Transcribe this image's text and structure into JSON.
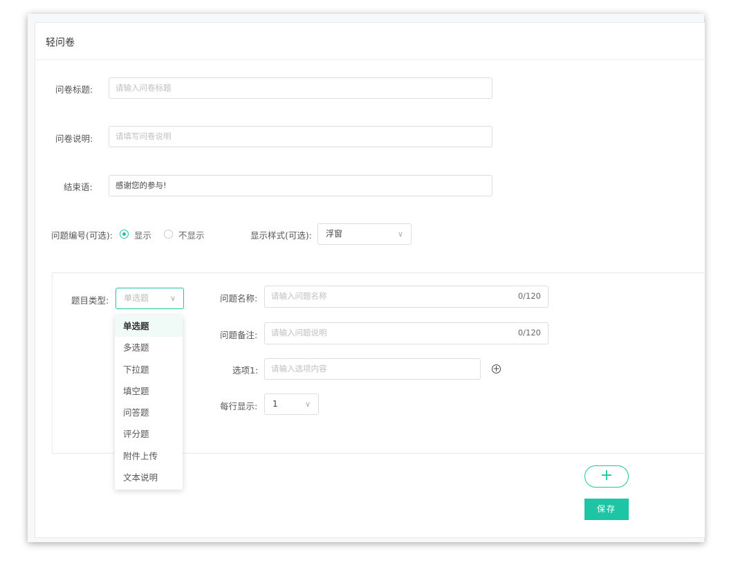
{
  "header": {
    "title": "轻问卷"
  },
  "form": {
    "title_label": "问卷标题:",
    "title_placeholder": "请输入问卷标题",
    "desc_label": "问卷说明:",
    "desc_placeholder": "请填写问卷说明",
    "end_label": "结束语:",
    "end_value": "感谢您的参与!",
    "numbering_label": "问题编号(可选):",
    "numbering_options": [
      "显示",
      "不显示"
    ],
    "numbering_selected": "显示",
    "style_label": "显示样式(可选):",
    "style_value": "浮窗"
  },
  "question": {
    "type_label": "题目类型:",
    "type_placeholder": "单选题",
    "type_options": [
      "单选题",
      "多选题",
      "下拉题",
      "填空题",
      "问答题",
      "评分题",
      "附件上传",
      "文本说明"
    ],
    "type_highlighted": "单选题",
    "name_label": "问题名称:",
    "name_placeholder": "请输入问题名称",
    "name_counter": "0/120",
    "note_label": "问题备注:",
    "note_placeholder": "请输入问题说明",
    "note_counter": "0/120",
    "option1_label": "选项1:",
    "option1_placeholder": "请输入选项内容",
    "per_row_label": "每行显示:",
    "per_row_value": "1"
  },
  "actions": {
    "add_symbol": "+",
    "save_label": "保存"
  },
  "colors": {
    "accent": "#1cc5a4",
    "border": "#d9dde3"
  },
  "icons": {
    "chevron": "chevron-down-icon",
    "add_option": "plus-circle-icon",
    "add_question": "plus-icon"
  }
}
